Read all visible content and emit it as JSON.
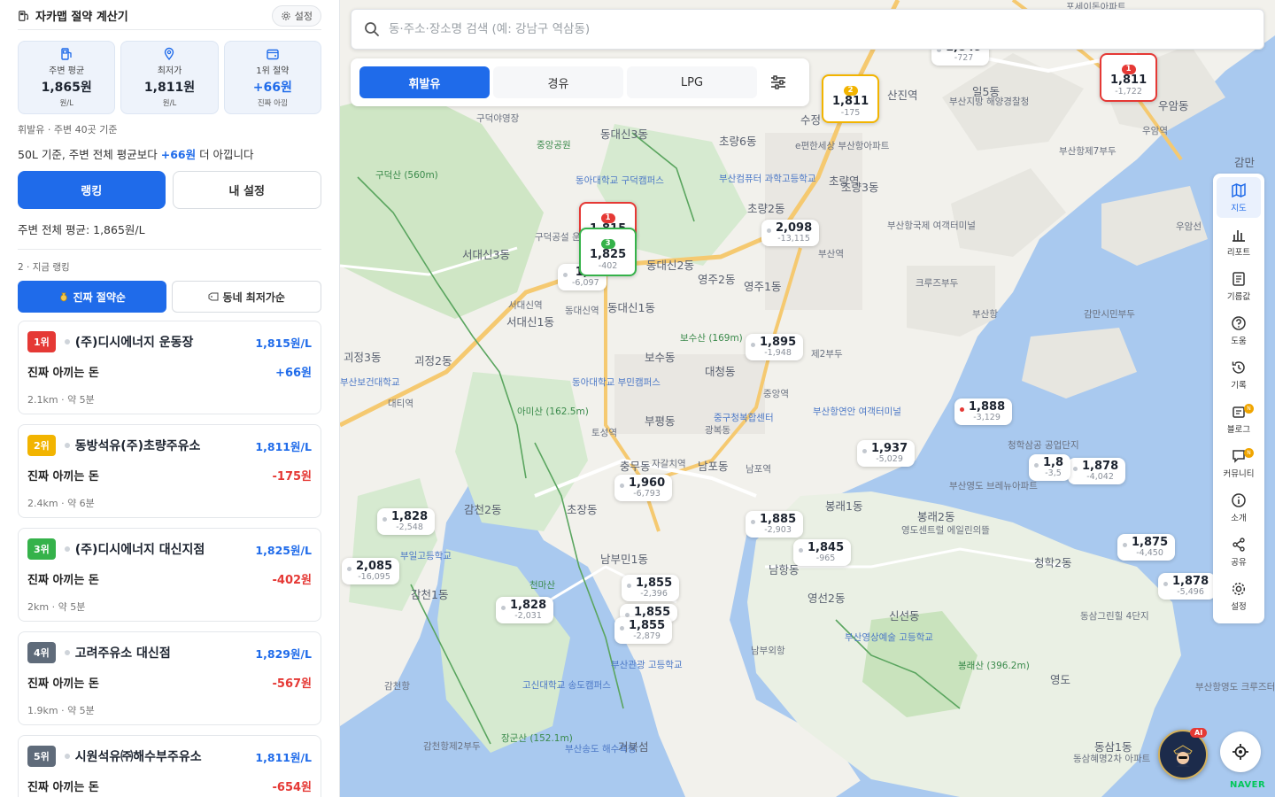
{
  "header": {
    "title": "자카맵 절약 계산기",
    "settings_label": "설정"
  },
  "stats": [
    {
      "label": "주변 평균",
      "value": "1,865원",
      "sub": "원/L"
    },
    {
      "label": "최저가",
      "value": "1,811원",
      "sub": "원/L"
    },
    {
      "label": "1위 절약",
      "value": "+66원",
      "sub": "진짜 아낌"
    }
  ],
  "info_line1": "휘발유 · 주변 40곳 기준",
  "info_line2_pre": "50L 기준, 주변 전체 평균보다 ",
  "info_line2_amount": "+66원",
  "info_line2_post": " 더 아낍니다",
  "buttons": {
    "ranking": "랭킹",
    "my_settings": "내 설정"
  },
  "average_text": "주변 전체 평균: 1,865원/L",
  "section_label": "2 · 지금 랭킹",
  "sort": {
    "real_saving": "진짜 절약순",
    "cheapest": "동네 최저가순"
  },
  "ranking": [
    {
      "rank": "1위",
      "rank_color": "#e53935",
      "name": "(주)디시에너지 운동장",
      "price": "1,815원/L",
      "saving_label": "진짜 아끼는 돈",
      "saving": "+66원",
      "saving_positive": true,
      "meta": "2.1km · 약 5분"
    },
    {
      "rank": "2위",
      "rank_color": "#f2b400",
      "name": "동방석유(주)초량주유소",
      "price": "1,811원/L",
      "saving_label": "진짜 아끼는 돈",
      "saving": "-175원",
      "saving_positive": false,
      "meta": "2.4km · 약 6분"
    },
    {
      "rank": "3위",
      "rank_color": "#35b24a",
      "name": "(주)디시에너지 대신지점",
      "price": "1,825원/L",
      "saving_label": "진짜 아끼는 돈",
      "saving": "-402원",
      "saving_positive": false,
      "meta": "2km · 약 5분"
    },
    {
      "rank": "4위",
      "rank_color": "#5f6b7a",
      "name": "고려주유소 대신점",
      "price": "1,829원/L",
      "saving_label": "진짜 아끼는 돈",
      "saving": "-567원",
      "saving_positive": false,
      "meta": "1.9km · 약 5분"
    },
    {
      "rank": "5위",
      "rank_color": "#5f6b7a",
      "name": "시원석유㈜해수부주유소",
      "price": "1,811원/L",
      "saving_label": "진짜 아끼는 돈",
      "saving": "-654원",
      "saving_positive": false,
      "meta": ""
    }
  ],
  "map": {
    "search_placeholder": "동·주소·장소명 검색 (예: 강남구 역삼동)",
    "fuel_tabs": [
      "휘발유",
      "경유",
      "LPG"
    ],
    "place_labels": [
      "구덕야영장",
      "동대신3동",
      "초량6동",
      "중앙공원",
      "동아대학교 구덕캠퍼스",
      "부산컴퓨터 과학고등학교",
      "구덕산 (560m)",
      "초량역",
      "초량3동",
      "초량2동",
      "서대신3동",
      "구덕공설 운동장",
      "부산항국제 여객터미널",
      "크루즈부두",
      "영주2동",
      "영주1동",
      "동대신2동",
      "서대신역",
      "동대신역",
      "동대신1동",
      "서대신1동",
      "부산항",
      "감만시민부두",
      "보수산 (169m)",
      "보수동",
      "대청동",
      "중앙역",
      "제2부두",
      "괴정3동",
      "괴정2동",
      "부산보건대학교",
      "대티역",
      "동아대학교 부민캠퍼스",
      "아미산 (162.5m)",
      "부평동",
      "부산항연안 여객터미널",
      "토성역",
      "중구청복합센터",
      "광복동",
      "남포동",
      "남포역",
      "자갈치역",
      "충무동",
      "감천2동",
      "초장동",
      "봉래1동",
      "봉래2동",
      "영도센트럴 에일린의뜰",
      "부산영도 브레뉴아파트",
      "청학2동",
      "청학삼공 공업단지",
      "남부민1동",
      "천마산",
      "부일고등학교",
      "감천1동",
      "남항동",
      "영선2동",
      "신선동",
      "동삼그린힐 4단지",
      "부산영상예술 고등학교",
      "남부외항",
      "봉래산 (396.2m)",
      "영도",
      "감천항",
      "고신대학교 송도캠퍼스",
      "부산관광 고등학교",
      "장군산 (152.1m)",
      "부산송도 해수욕장",
      "거북섬",
      "감천항제2부두",
      "동삼1동",
      "동삼혜명2차 아파트",
      "부산항영도 크루즈터미널",
      "우암동",
      "우암역",
      "부산항제7부두",
      "부산지방 해양경찰청",
      "일5동",
      "e편한세상 부산항아파트",
      "부산역",
      "수정",
      "산진역",
      "포세이돈아파트",
      "감만",
      "대체",
      "우암선"
    ],
    "price_markers": [
      {
        "price": "2,098",
        "diff": "-13,115"
      },
      {
        "price": "1,895",
        "diff": "-1,948"
      },
      {
        "price": "1,888",
        "diff": "-3,129"
      },
      {
        "price": "1,937",
        "diff": "-5,029"
      },
      {
        "price": "1,878",
        "diff": "-4,042"
      },
      {
        "price": "1,960",
        "diff": "-6,793"
      },
      {
        "price": "1,885",
        "diff": "-2,903"
      },
      {
        "price": "1,845",
        "diff": "-965"
      },
      {
        "price": "1,875",
        "diff": "-4,450"
      },
      {
        "price": "1,878",
        "diff": "-5,496"
      },
      {
        "price": "1,828",
        "diff": "-2,548"
      },
      {
        "price": "2,085",
        "diff": "-16,095"
      },
      {
        "price": "1,855",
        "diff": "-2,396"
      },
      {
        "price": "1,855",
        "diff": ""
      },
      {
        "price": "1,855",
        "diff": "-2,879"
      },
      {
        "price": "1,828",
        "diff": "-2,031"
      },
      {
        "price": "1,8",
        "diff": "-6,097"
      },
      {
        "price": "1,8",
        "diff": "-3,5"
      },
      {
        "price": "1,849",
        "diff": "-727"
      }
    ],
    "top_markers": [
      {
        "badge": "1",
        "price": "1,815",
        "diff": "",
        "color": "#e53935"
      },
      {
        "badge": "3",
        "price": "1,825",
        "diff": "-402",
        "color": "#35b24a"
      },
      {
        "badge": "2",
        "price": "1,811",
        "diff": "-175",
        "color": "#f2b400"
      },
      {
        "badge": "1",
        "price": "1,811",
        "diff": "-1,722",
        "color": "#e53935"
      }
    ],
    "toolbar": [
      "지도",
      "리포트",
      "기름값",
      "도움",
      "기록",
      "블로그",
      "커뮤니티",
      "소개",
      "공유",
      "설정"
    ],
    "ai_label": "AI",
    "brand": "NAVER"
  }
}
